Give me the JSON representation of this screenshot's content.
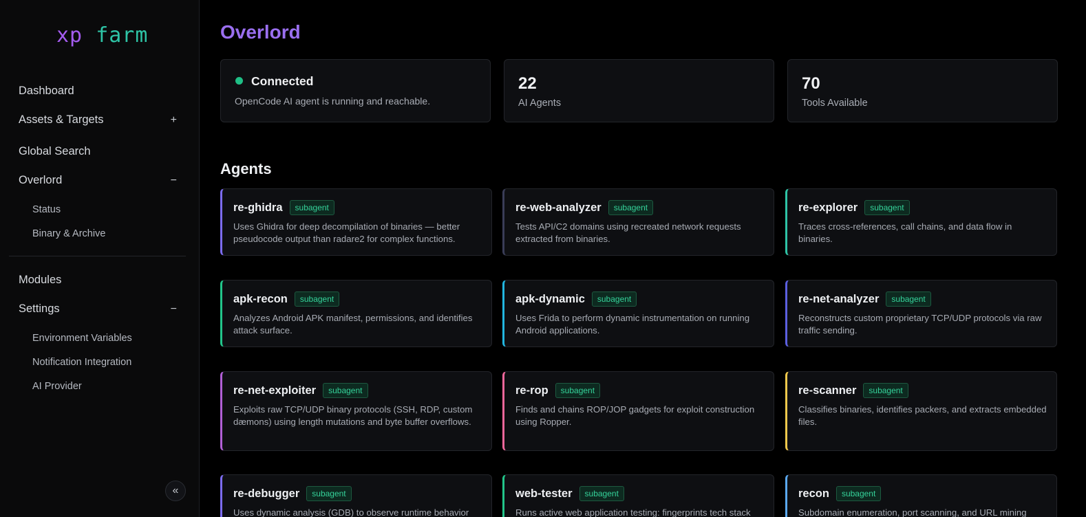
{
  "sidebar": {
    "logo_a": "xp",
    "logo_b": "farm",
    "items": [
      {
        "label": "Dashboard"
      },
      {
        "label": "Assets & Targets",
        "toggle": "+"
      },
      {
        "label": "Global Search"
      },
      {
        "label": "Overlord",
        "toggle": "−"
      },
      {
        "label": "Modules"
      },
      {
        "label": "Settings",
        "toggle": "−"
      }
    ],
    "overlord_sub": [
      "Status",
      "Binary & Archive"
    ],
    "settings_sub": [
      "Environment Variables",
      "Notification Integration",
      "AI Provider"
    ],
    "collapse_icon": "«"
  },
  "main": {
    "title": "Overlord",
    "status": {
      "title": "Connected",
      "desc": "OpenCode AI agent is running and reachable.",
      "color": "#1fbf86"
    },
    "stats": [
      {
        "value": "22",
        "label": "AI Agents"
      },
      {
        "value": "70",
        "label": "Tools Available"
      }
    ],
    "agents_title": "Agents",
    "badge": "subagent",
    "agents": [
      {
        "name": "re-ghidra",
        "desc": "Uses Ghidra for deep decompilation of binaries — better pseudocode output than radare2 for complex functions.",
        "accent": "#7c6cf0"
      },
      {
        "name": "re-web-analyzer",
        "desc": "Tests API/C2 domains using recreated network requests extracted from binaries.",
        "accent": "#3a3d57"
      },
      {
        "name": "re-explorer",
        "desc": "Traces cross-references, call chains, and data flow in binaries.",
        "accent": "#2ec4a6"
      },
      {
        "name": "apk-recon",
        "desc": "Analyzes Android APK manifest, permissions, and identifies attack surface.",
        "accent": "#22c58a"
      },
      {
        "name": "apk-dynamic",
        "desc": "Uses Frida to perform dynamic instrumentation on running Android applications.",
        "accent": "#22b6e0"
      },
      {
        "name": "re-net-analyzer",
        "desc": "Reconstructs custom proprietary TCP/UDP protocols via raw traffic sending.",
        "accent": "#5b5fe0"
      },
      {
        "name": "re-net-exploiter",
        "desc": "Exploits raw TCP/UDP binary protocols (SSH, RDP, custom dæmons) using length mutations and byte buffer overflows.",
        "accent": "#b15fd6"
      },
      {
        "name": "re-rop",
        "desc": "Finds and chains ROP/JOP gadgets for exploit construction using Ropper.",
        "accent": "#f0679b"
      },
      {
        "name": "re-scanner",
        "desc": "Classifies binaries, identifies packers, and extracts embedded files.",
        "accent": "#f2c94c"
      },
      {
        "name": "re-debugger",
        "desc": "Uses dynamic analysis (GDB) to observe runtime behavior",
        "accent": "#7c6cf0"
      },
      {
        "name": "web-tester",
        "desc": "Runs active web application testing: fingerprints tech stack",
        "accent": "#22c58a"
      },
      {
        "name": "recon",
        "desc": "Subdomain enumeration, port scanning, and URL mining",
        "accent": "#5aa8f0"
      }
    ]
  }
}
